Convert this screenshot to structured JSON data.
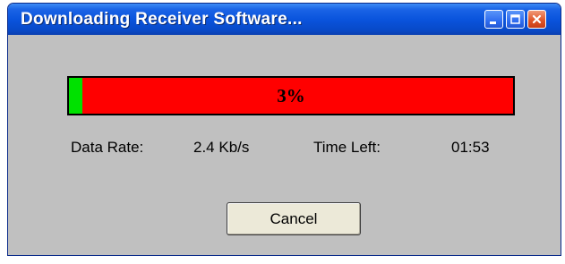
{
  "window": {
    "title": "Downloading Receiver Software..."
  },
  "titlebar_buttons": {
    "minimize_icon": "minimize-icon",
    "maximize_icon": "maximize-icon",
    "close_icon": "close-icon"
  },
  "progress": {
    "percent": 3,
    "label": "3%",
    "fill_color": "#00e100",
    "track_color": "#ff0000"
  },
  "stats": {
    "data_rate_label": "Data Rate:",
    "data_rate_value": "2.4 Kb/s",
    "time_left_label": "Time Left:",
    "time_left_value": "01:53"
  },
  "actions": {
    "cancel_label": "Cancel"
  }
}
